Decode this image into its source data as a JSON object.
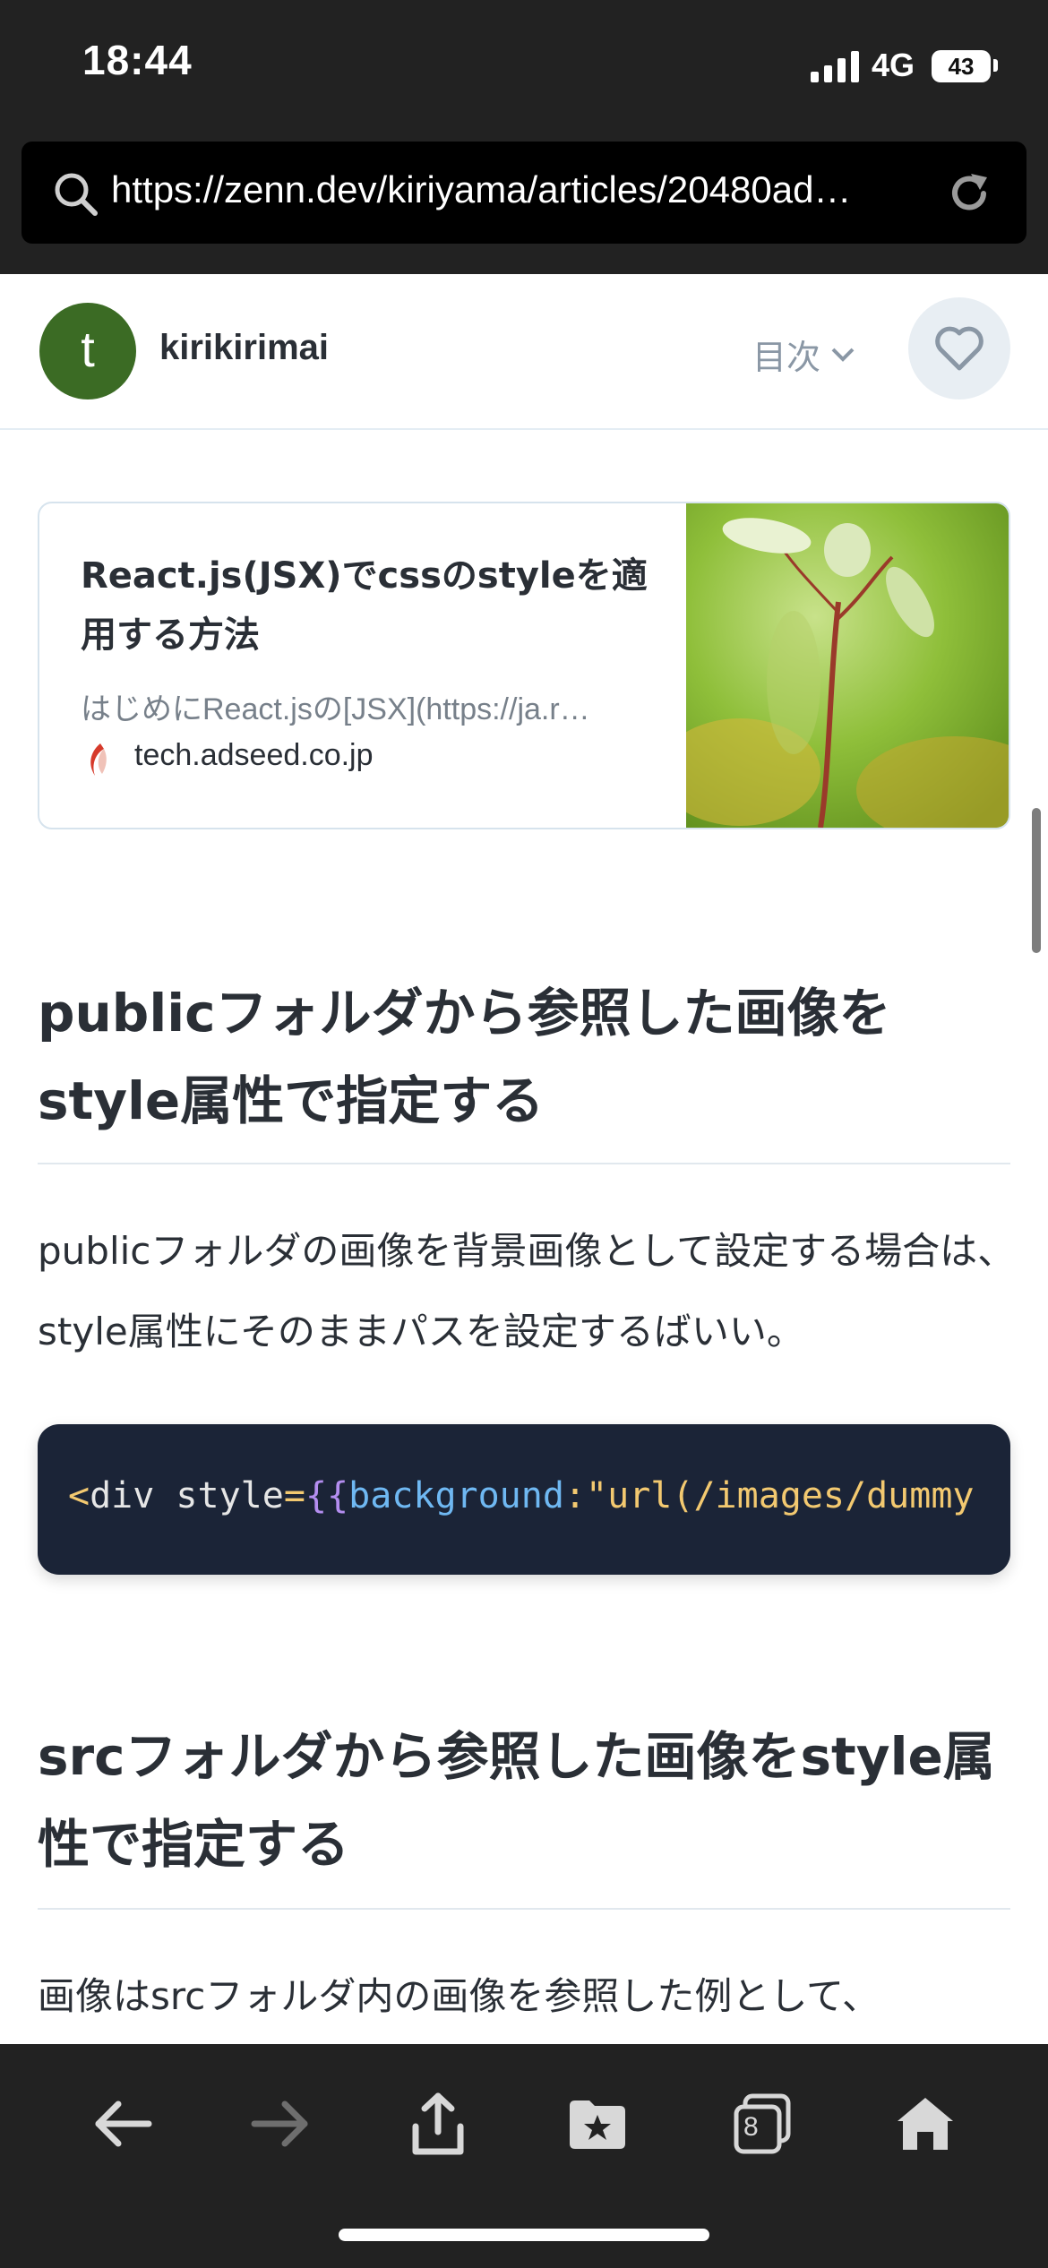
{
  "status_bar": {
    "time": "18:44",
    "network": "4G",
    "battery": "43"
  },
  "browser": {
    "url": "https://zenn.dev/kiriyama/articles/20480ad…"
  },
  "article_header": {
    "avatar_letter": "t",
    "author": "kirikirimai",
    "toc_label": "目次"
  },
  "link_card": {
    "title": "React.js(JSX)でcssのstyleを適用する方法",
    "description": "はじめにReact.jsの[JSX](https://ja.r…",
    "domain": "tech.adseed.co.jp"
  },
  "sections": [
    {
      "heading": "publicフォルダから参照した画像をstyle属性で指定する",
      "paragraph": "publicフォルダの画像を背景画像として設定する場合は、style属性にそのままパスを設定するばいい。"
    },
    {
      "heading": "srcフォルダから参照した画像をstyle属性で指定する",
      "paragraph": "画像はsrcフォルダ内の画像を参照した例として、"
    }
  ],
  "code": {
    "tokens": [
      {
        "text": "<",
        "color": "#f3c970"
      },
      {
        "text": "div style",
        "color": "#e6e6e6"
      },
      {
        "text": "=",
        "color": "#f3c970"
      },
      {
        "text": "{{",
        "color": "#b48ef0"
      },
      {
        "text": "background",
        "color": "#6fb8f2"
      },
      {
        "text": ":",
        "color": "#f3c970"
      },
      {
        "text": "\"url(/images/dummy",
        "color": "#f3c970"
      }
    ]
  },
  "toolbar": {
    "tabs_count": "8"
  },
  "colors": {
    "chrome": "#222222",
    "code_bg": "#1b2437",
    "avatar": "#3b6b24",
    "text": "#2a2f36",
    "muted": "#8a97a5"
  }
}
